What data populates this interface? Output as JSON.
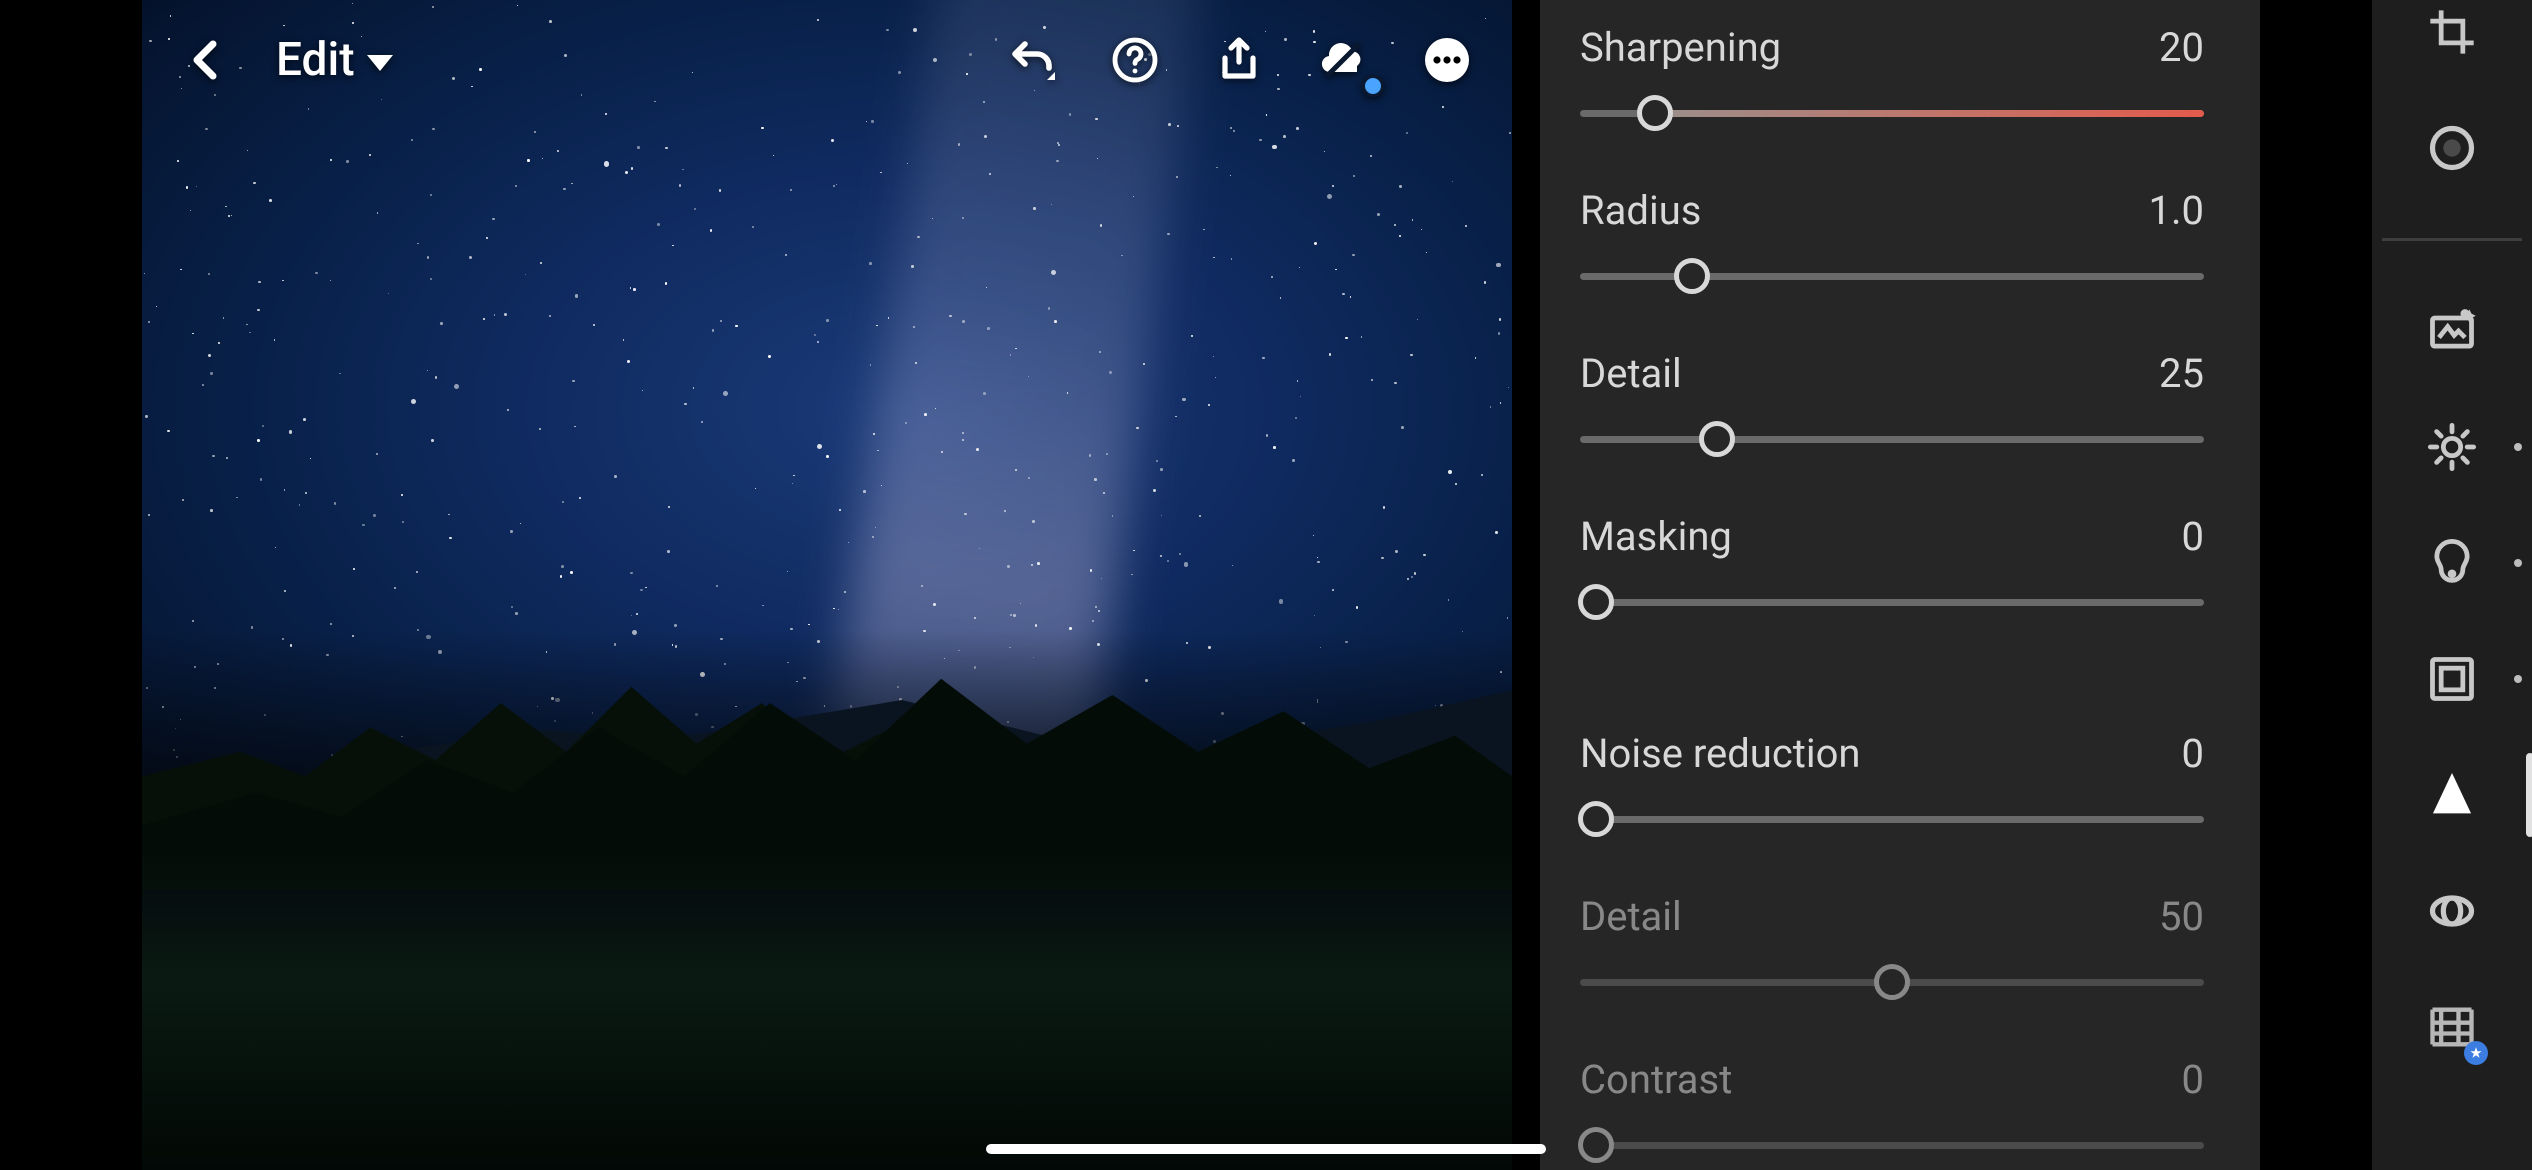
{
  "toolbar": {
    "edit_label": "Edit"
  },
  "panel": {
    "sliders": [
      {
        "label": "Sharpening",
        "value": "20",
        "pos": 12,
        "tint_from": 12,
        "tint_color1": "#9a8f8b",
        "tint_color2": "#e45b4c",
        "dim": false
      },
      {
        "label": "Radius",
        "value": "1.0",
        "pos": 18,
        "dim": false
      },
      {
        "label": "Detail",
        "value": "25",
        "pos": 22,
        "dim": false
      },
      {
        "label": "Masking",
        "value": "0",
        "pos": 2.5,
        "dim": false
      },
      {
        "label": "Noise reduction",
        "value": "0",
        "pos": 2.5,
        "dim": false
      },
      {
        "label": "Detail",
        "value": "50",
        "pos": 50,
        "dim": true
      },
      {
        "label": "Contrast",
        "value": "0",
        "pos": 2.5,
        "dim": true
      }
    ]
  },
  "rail": {
    "items": [
      {
        "name": "crop",
        "tick": false
      },
      {
        "name": "healing",
        "tick": false
      },
      {
        "name": "presets",
        "tick": false
      },
      {
        "name": "light",
        "tick": true
      },
      {
        "name": "color",
        "tick": true
      },
      {
        "name": "effects",
        "tick": true
      },
      {
        "name": "detail",
        "active": true
      },
      {
        "name": "optics",
        "tick": false
      },
      {
        "name": "geometry",
        "tick": false
      }
    ]
  }
}
